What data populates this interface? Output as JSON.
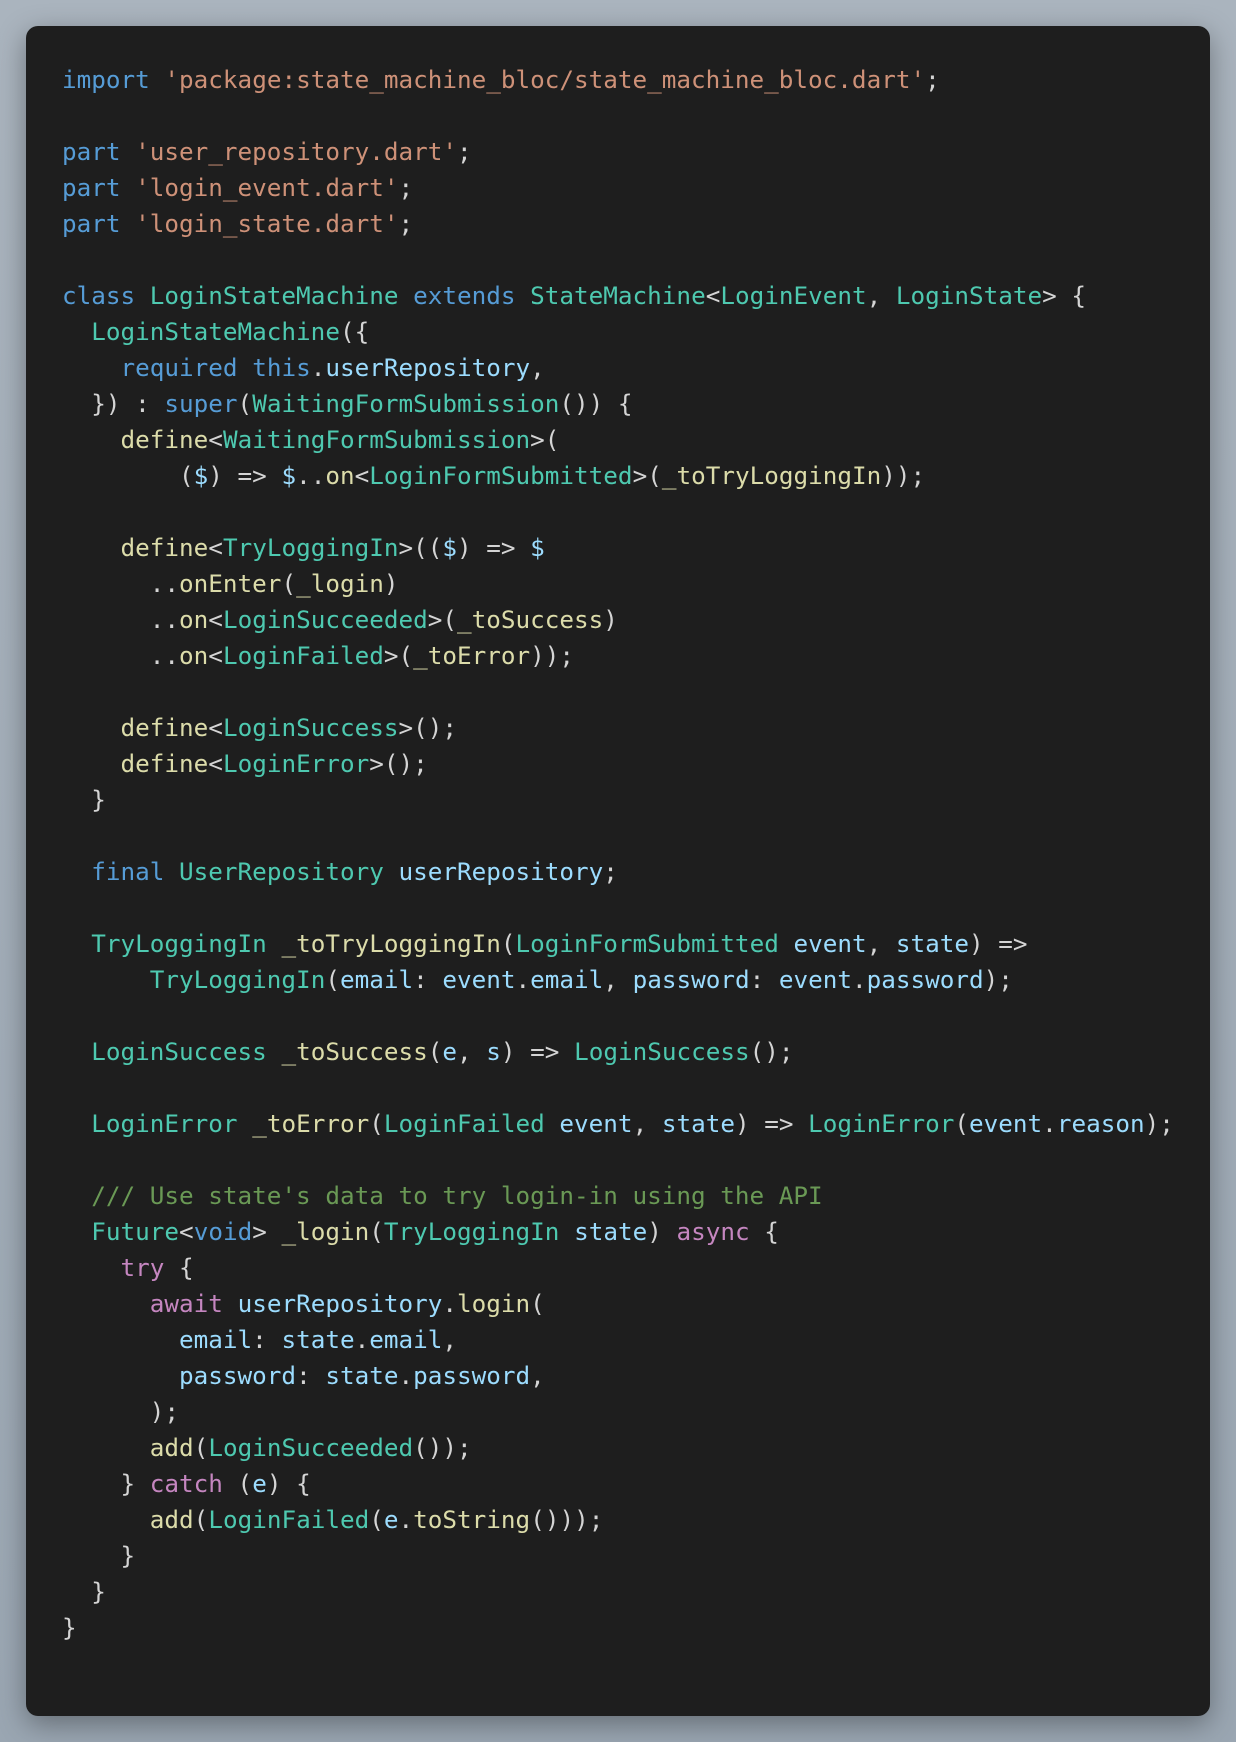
{
  "colors": {
    "background": "#9ca8b4",
    "editor": "#1e1e1e",
    "keyword": "#569cd6",
    "string": "#ce9178",
    "type": "#4ec9b0",
    "function": "#dcdcaa",
    "variable": "#9cdcfe",
    "control": "#c586c0",
    "comment": "#6a9955",
    "plain": "#d4d4d4"
  },
  "code": {
    "language": "dart",
    "lines": [
      [
        [
          "kw",
          "import"
        ],
        [
          "pl",
          " "
        ],
        [
          "str",
          "'package:state_machine_bloc/state_machine_bloc.dart'"
        ],
        [
          "pl",
          ";"
        ]
      ],
      [],
      [
        [
          "kw",
          "part"
        ],
        [
          "pl",
          " "
        ],
        [
          "str",
          "'user_repository.dart'"
        ],
        [
          "pl",
          ";"
        ]
      ],
      [
        [
          "kw",
          "part"
        ],
        [
          "pl",
          " "
        ],
        [
          "str",
          "'login_event.dart'"
        ],
        [
          "pl",
          ";"
        ]
      ],
      [
        [
          "kw",
          "part"
        ],
        [
          "pl",
          " "
        ],
        [
          "str",
          "'login_state.dart'"
        ],
        [
          "pl",
          ";"
        ]
      ],
      [],
      [
        [
          "kw",
          "class"
        ],
        [
          "pl",
          " "
        ],
        [
          "ty",
          "LoginStateMachine"
        ],
        [
          "pl",
          " "
        ],
        [
          "kw",
          "extends"
        ],
        [
          "pl",
          " "
        ],
        [
          "ty",
          "StateMachine"
        ],
        [
          "pl",
          "<"
        ],
        [
          "ty",
          "LoginEvent"
        ],
        [
          "pl",
          ", "
        ],
        [
          "ty",
          "LoginState"
        ],
        [
          "pl",
          "> {"
        ]
      ],
      [
        [
          "pl",
          "  "
        ],
        [
          "ty",
          "LoginStateMachine"
        ],
        [
          "pl",
          "({"
        ]
      ],
      [
        [
          "pl",
          "    "
        ],
        [
          "kw",
          "required"
        ],
        [
          "pl",
          " "
        ],
        [
          "kw",
          "this"
        ],
        [
          "pl",
          "."
        ],
        [
          "var",
          "userRepository"
        ],
        [
          "pl",
          ","
        ]
      ],
      [
        [
          "pl",
          "  }) : "
        ],
        [
          "kw",
          "super"
        ],
        [
          "pl",
          "("
        ],
        [
          "ty",
          "WaitingFormSubmission"
        ],
        [
          "pl",
          "()) {"
        ]
      ],
      [
        [
          "pl",
          "    "
        ],
        [
          "fn",
          "define"
        ],
        [
          "pl",
          "<"
        ],
        [
          "ty",
          "WaitingFormSubmission"
        ],
        [
          "pl",
          ">("
        ]
      ],
      [
        [
          "pl",
          "        ("
        ],
        [
          "var",
          "$"
        ],
        [
          "pl",
          ") => "
        ],
        [
          "var",
          "$"
        ],
        [
          "pl",
          ".."
        ],
        [
          "fn",
          "on"
        ],
        [
          "pl",
          "<"
        ],
        [
          "ty",
          "LoginFormSubmitted"
        ],
        [
          "pl",
          ">("
        ],
        [
          "fn",
          "_toTryLoggingIn"
        ],
        [
          "pl",
          "));"
        ]
      ],
      [],
      [
        [
          "pl",
          "    "
        ],
        [
          "fn",
          "define"
        ],
        [
          "pl",
          "<"
        ],
        [
          "ty",
          "TryLoggingIn"
        ],
        [
          "pl",
          ">(("
        ],
        [
          "var",
          "$"
        ],
        [
          "pl",
          ") => "
        ],
        [
          "var",
          "$"
        ]
      ],
      [
        [
          "pl",
          "      .."
        ],
        [
          "fn",
          "onEnter"
        ],
        [
          "pl",
          "("
        ],
        [
          "fn",
          "_login"
        ],
        [
          "pl",
          ")"
        ]
      ],
      [
        [
          "pl",
          "      .."
        ],
        [
          "fn",
          "on"
        ],
        [
          "pl",
          "<"
        ],
        [
          "ty",
          "LoginSucceeded"
        ],
        [
          "pl",
          ">("
        ],
        [
          "fn",
          "_toSuccess"
        ],
        [
          "pl",
          ")"
        ]
      ],
      [
        [
          "pl",
          "      .."
        ],
        [
          "fn",
          "on"
        ],
        [
          "pl",
          "<"
        ],
        [
          "ty",
          "LoginFailed"
        ],
        [
          "pl",
          ">("
        ],
        [
          "fn",
          "_toError"
        ],
        [
          "pl",
          "));"
        ]
      ],
      [],
      [
        [
          "pl",
          "    "
        ],
        [
          "fn",
          "define"
        ],
        [
          "pl",
          "<"
        ],
        [
          "ty",
          "LoginSuccess"
        ],
        [
          "pl",
          ">();"
        ]
      ],
      [
        [
          "pl",
          "    "
        ],
        [
          "fn",
          "define"
        ],
        [
          "pl",
          "<"
        ],
        [
          "ty",
          "LoginError"
        ],
        [
          "pl",
          ">();"
        ]
      ],
      [
        [
          "pl",
          "  }"
        ]
      ],
      [],
      [
        [
          "pl",
          "  "
        ],
        [
          "kw",
          "final"
        ],
        [
          "pl",
          " "
        ],
        [
          "ty",
          "UserRepository"
        ],
        [
          "pl",
          " "
        ],
        [
          "var",
          "userRepository"
        ],
        [
          "pl",
          ";"
        ]
      ],
      [],
      [
        [
          "pl",
          "  "
        ],
        [
          "ty",
          "TryLoggingIn"
        ],
        [
          "pl",
          " "
        ],
        [
          "fn",
          "_toTryLoggingIn"
        ],
        [
          "pl",
          "("
        ],
        [
          "ty",
          "LoginFormSubmitted"
        ],
        [
          "pl",
          " "
        ],
        [
          "var",
          "event"
        ],
        [
          "pl",
          ", "
        ],
        [
          "var",
          "state"
        ],
        [
          "pl",
          ") =>"
        ]
      ],
      [
        [
          "pl",
          "      "
        ],
        [
          "ty",
          "TryLoggingIn"
        ],
        [
          "pl",
          "("
        ],
        [
          "var",
          "email"
        ],
        [
          "pl",
          ": "
        ],
        [
          "var",
          "event"
        ],
        [
          "pl",
          "."
        ],
        [
          "var",
          "email"
        ],
        [
          "pl",
          ", "
        ],
        [
          "var",
          "password"
        ],
        [
          "pl",
          ": "
        ],
        [
          "var",
          "event"
        ],
        [
          "pl",
          "."
        ],
        [
          "var",
          "password"
        ],
        [
          "pl",
          ");"
        ]
      ],
      [],
      [
        [
          "pl",
          "  "
        ],
        [
          "ty",
          "LoginSuccess"
        ],
        [
          "pl",
          " "
        ],
        [
          "fn",
          "_toSuccess"
        ],
        [
          "pl",
          "("
        ],
        [
          "var",
          "e"
        ],
        [
          "pl",
          ", "
        ],
        [
          "var",
          "s"
        ],
        [
          "pl",
          ") => "
        ],
        [
          "ty",
          "LoginSuccess"
        ],
        [
          "pl",
          "();"
        ]
      ],
      [],
      [
        [
          "pl",
          "  "
        ],
        [
          "ty",
          "LoginError"
        ],
        [
          "pl",
          " "
        ],
        [
          "fn",
          "_toError"
        ],
        [
          "pl",
          "("
        ],
        [
          "ty",
          "LoginFailed"
        ],
        [
          "pl",
          " "
        ],
        [
          "var",
          "event"
        ],
        [
          "pl",
          ", "
        ],
        [
          "var",
          "state"
        ],
        [
          "pl",
          ") => "
        ],
        [
          "ty",
          "LoginError"
        ],
        [
          "pl",
          "("
        ],
        [
          "var",
          "event"
        ],
        [
          "pl",
          "."
        ],
        [
          "var",
          "reason"
        ],
        [
          "pl",
          ");"
        ]
      ],
      [],
      [
        [
          "pl",
          "  "
        ],
        [
          "com",
          "/// Use state's data to try login-in using the API"
        ]
      ],
      [
        [
          "pl",
          "  "
        ],
        [
          "ty",
          "Future"
        ],
        [
          "pl",
          "<"
        ],
        [
          "kw",
          "void"
        ],
        [
          "pl",
          "> "
        ],
        [
          "fn",
          "_login"
        ],
        [
          "pl",
          "("
        ],
        [
          "ty",
          "TryLoggingIn"
        ],
        [
          "pl",
          " "
        ],
        [
          "var",
          "state"
        ],
        [
          "pl",
          ") "
        ],
        [
          "ctl",
          "async"
        ],
        [
          "pl",
          " {"
        ]
      ],
      [
        [
          "pl",
          "    "
        ],
        [
          "ctl",
          "try"
        ],
        [
          "pl",
          " {"
        ]
      ],
      [
        [
          "pl",
          "      "
        ],
        [
          "ctl",
          "await"
        ],
        [
          "pl",
          " "
        ],
        [
          "var",
          "userRepository"
        ],
        [
          "pl",
          "."
        ],
        [
          "fn",
          "login"
        ],
        [
          "pl",
          "("
        ]
      ],
      [
        [
          "pl",
          "        "
        ],
        [
          "var",
          "email"
        ],
        [
          "pl",
          ": "
        ],
        [
          "var",
          "state"
        ],
        [
          "pl",
          "."
        ],
        [
          "var",
          "email"
        ],
        [
          "pl",
          ","
        ]
      ],
      [
        [
          "pl",
          "        "
        ],
        [
          "var",
          "password"
        ],
        [
          "pl",
          ": "
        ],
        [
          "var",
          "state"
        ],
        [
          "pl",
          "."
        ],
        [
          "var",
          "password"
        ],
        [
          "pl",
          ","
        ]
      ],
      [
        [
          "pl",
          "      );"
        ]
      ],
      [
        [
          "pl",
          "      "
        ],
        [
          "fn",
          "add"
        ],
        [
          "pl",
          "("
        ],
        [
          "ty",
          "LoginSucceeded"
        ],
        [
          "pl",
          "());"
        ]
      ],
      [
        [
          "pl",
          "    } "
        ],
        [
          "ctl",
          "catch"
        ],
        [
          "pl",
          " ("
        ],
        [
          "var",
          "e"
        ],
        [
          "pl",
          ") {"
        ]
      ],
      [
        [
          "pl",
          "      "
        ],
        [
          "fn",
          "add"
        ],
        [
          "pl",
          "("
        ],
        [
          "ty",
          "LoginFailed"
        ],
        [
          "pl",
          "("
        ],
        [
          "var",
          "e"
        ],
        [
          "pl",
          "."
        ],
        [
          "fn",
          "toString"
        ],
        [
          "pl",
          "()));"
        ]
      ],
      [
        [
          "pl",
          "    }"
        ]
      ],
      [
        [
          "pl",
          "  }"
        ]
      ],
      [
        [
          "pl",
          "}"
        ]
      ]
    ]
  }
}
